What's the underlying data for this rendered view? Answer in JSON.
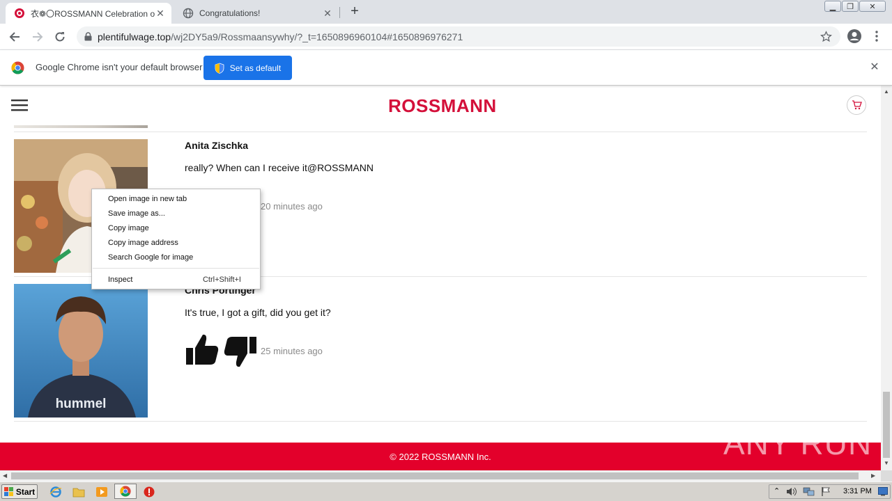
{
  "browser": {
    "tabs": [
      {
        "title": "ROSSMANN Celebration of the",
        "title_prefix_glyphs": "衣❁〇",
        "active": true
      },
      {
        "title": "Congratulations!",
        "active": false
      }
    ],
    "url": {
      "host": "plentifulwage.top",
      "path": "/wj2DY5a9/Rossmaansywhy/?_t=1650896960104#1650896976271"
    },
    "infobar": {
      "message": "Google Chrome isn't your default browser",
      "button": "Set as default"
    }
  },
  "site": {
    "logo_text": "ROSSMANN",
    "brand_color": "#e3002b",
    "comments": [
      {
        "name": "Anita Zischka",
        "text": "really? When can I receive it@ROSSMANN",
        "time": "20 minutes ago"
      },
      {
        "name": "Chris Portinger",
        "text": "It's true, I got a gift, did you get it?",
        "time": "25 minutes ago",
        "avatar_shirt_text": "hummel"
      }
    ],
    "footer": "© 2022 ROSSMANN Inc."
  },
  "context_menu": {
    "items": [
      {
        "label": "Open image in new tab",
        "shortcut": ""
      },
      {
        "label": "Save image as...",
        "shortcut": ""
      },
      {
        "label": "Copy image",
        "shortcut": ""
      },
      {
        "label": "Copy image address",
        "shortcut": ""
      },
      {
        "label": "Search Google for image",
        "shortcut": ""
      },
      {
        "label": "Inspect",
        "shortcut": "Ctrl+Shift+I"
      }
    ]
  },
  "watermark": "ANY RUN",
  "taskbar": {
    "start": "Start",
    "clock": "3:31 PM"
  }
}
